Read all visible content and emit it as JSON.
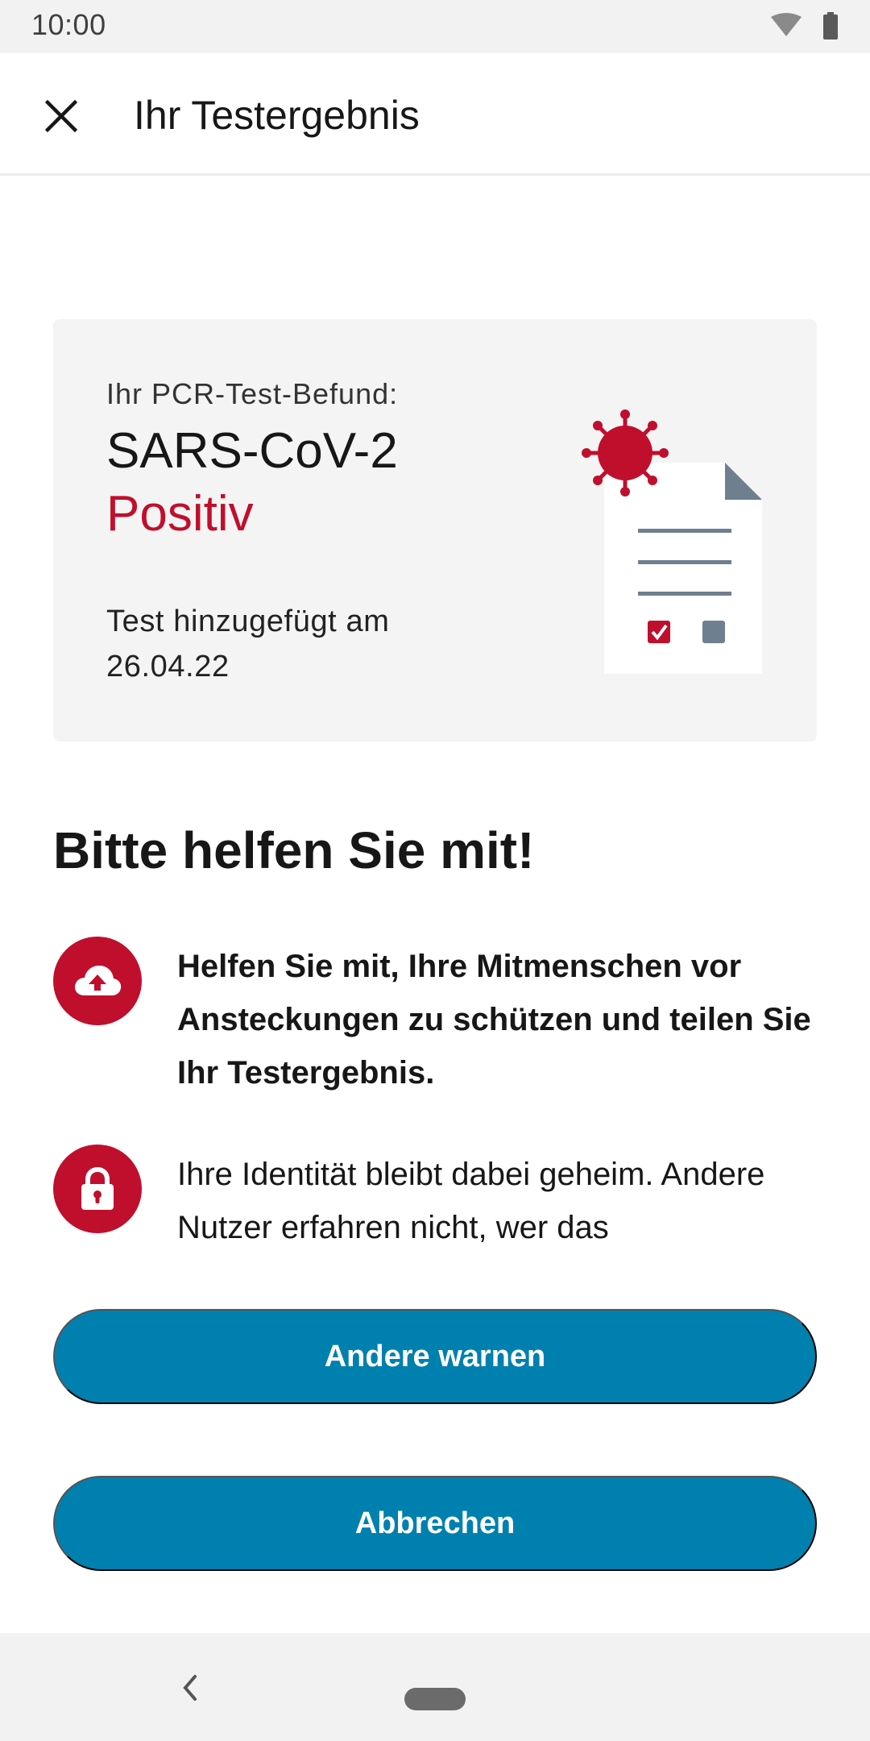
{
  "status_bar": {
    "time": "10:00"
  },
  "header": {
    "title": "Ihr Testergebnis",
    "close_icon": "close-icon"
  },
  "result_card": {
    "label": "Ihr PCR-Test-Befund:",
    "virus_name": "SARS-CoV-2",
    "result": "Positiv",
    "result_color": "#c00f2d",
    "date_label": "Test hinzugefügt am",
    "date": "26.04.22",
    "illustration_icon": "test-document-virus-icon"
  },
  "help": {
    "heading": "Bitte helfen Sie mit!",
    "items": [
      {
        "icon": "cloud-upload-icon",
        "text": "Helfen Sie mit, Ihre Mitmenschen vor Ansteckungen zu schützen und teilen Sie Ihr Testergebnis."
      },
      {
        "icon": "lock-icon",
        "text": "Ihre Identität bleibt dabei geheim. Andere Nutzer erfahren nicht, wer das"
      }
    ]
  },
  "buttons": {
    "warn_others": "Andere warnen",
    "cancel": "Abbrechen"
  },
  "colors": {
    "accent_blue": "#0080ae",
    "alert_red": "#c00f2d"
  }
}
